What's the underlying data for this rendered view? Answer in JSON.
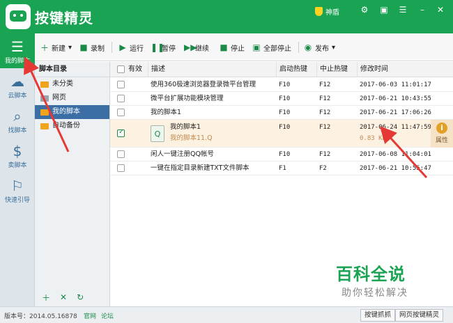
{
  "app": {
    "title": "按键精灵",
    "shield_label": "神盾"
  },
  "colors": {
    "accent": "#1aa352",
    "selected_row": "#fdf2e1",
    "folder": "#f0a41c",
    "annotation": "#e53935"
  },
  "sidenav": {
    "items": [
      {
        "label": "我的脚本",
        "icon": "list-icon"
      },
      {
        "label": "云脚本",
        "icon": "cloud-icon"
      },
      {
        "label": "找脚本",
        "icon": "search-icon"
      },
      {
        "label": "卖脚本",
        "icon": "dollar-icon"
      },
      {
        "label": "快速引导",
        "icon": "signpost-icon"
      }
    ]
  },
  "toolbar": {
    "new": "新建",
    "record": "录制",
    "run": "运行",
    "pause": "暂停",
    "resume": "继续",
    "stop": "停止",
    "stop_all": "全部停止",
    "publish": "发布"
  },
  "dirs": {
    "header": "脚本目录",
    "items": [
      {
        "label": "未分类"
      },
      {
        "label": "网页"
      },
      {
        "label": "我的脚本"
      },
      {
        "label": "自动备份"
      }
    ]
  },
  "table": {
    "columns": [
      "有效",
      "描述",
      "启动热键",
      "中止热键",
      "修改时间"
    ],
    "rows": [
      {
        "checked": false,
        "desc": "使用360极速浏览器登录微平台管理",
        "start": "F10",
        "stop": "F12",
        "time": "2017-06-03 11:01:17"
      },
      {
        "checked": false,
        "desc": "微平台扩展功能模块管理",
        "start": "F10",
        "stop": "F12",
        "time": "2017-06-21 10:43:55"
      },
      {
        "checked": false,
        "desc": "我的脚本1",
        "start": "F10",
        "stop": "F12",
        "time": "2017-06-21 17:06:26"
      },
      {
        "checked": true,
        "desc": "我的脚本1",
        "sub": "我的脚本11.Q",
        "start": "F10",
        "stop": "F12",
        "time": "2017-06-24 11:47:59",
        "size": "0.83 KB",
        "action": "属性"
      },
      {
        "checked": false,
        "desc": "闲人一键注册QQ帐号",
        "start": "F10",
        "stop": "F12",
        "time": "2017-06-08 11:04:01"
      },
      {
        "checked": false,
        "desc": "一键在指定目录新建TXT文件脚本",
        "start": "F1",
        "stop": "F2",
        "time": "2017-06-21 10:55:47"
      }
    ]
  },
  "status": {
    "version": "版本号：2014.05.16878",
    "link_site": "官网",
    "link_forum": "论坛",
    "btn_grab": "按键抓抓",
    "btn_web": "网页按键精灵"
  },
  "watermark": {
    "line1": "百科全说",
    "line2": "助你轻松解决"
  }
}
